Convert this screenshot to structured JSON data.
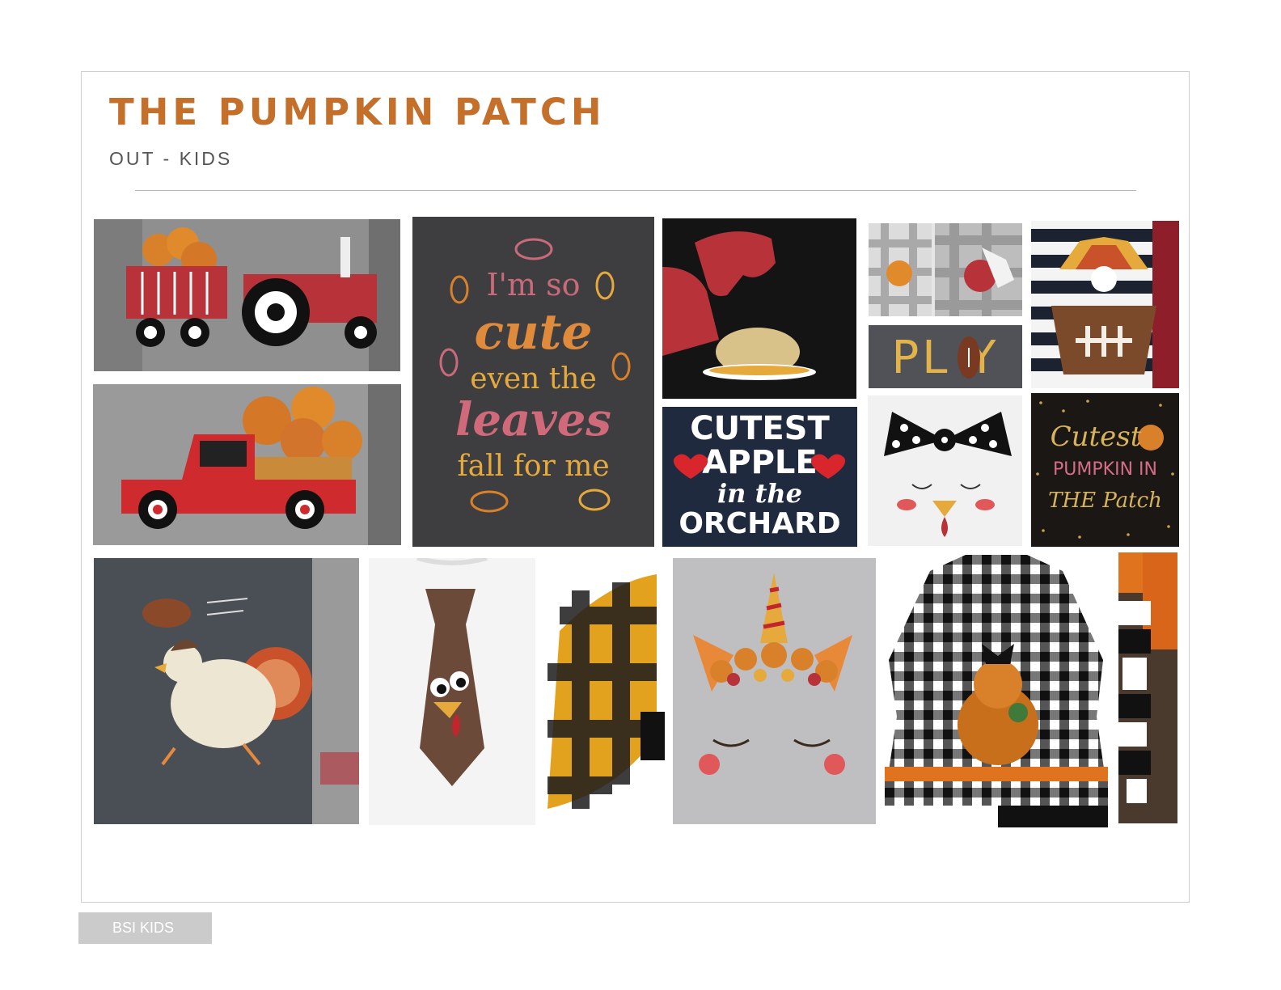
{
  "header": {
    "title": "THE PUMPKIN PATCH",
    "subtitle": "OUT - KIDS"
  },
  "tiles": {
    "cute_leaves": [
      "I'm so",
      "cute",
      "even the",
      "leaves",
      "fall for me"
    ],
    "cutest_apple": [
      "CUTEST",
      "APPLE",
      "in the",
      "ORCHARD"
    ],
    "play": "PL Y",
    "cutest_pumpkin": [
      "Cutest",
      "PUMPKIN IN",
      "THE Patch"
    ]
  },
  "images": {
    "tractor": "gray raglan tee with red tractor pulling pumpkin wagon",
    "truck": "gray tee with red truck carrying pumpkins",
    "trex": "black tee with t-rex eating turkey",
    "turkey_gingham": "gingham turkey applique outfits",
    "turkey_football": "striped tee with turkey holding football",
    "bow_turkey": "white tee with polka dot bow turkey face",
    "football_turkey": "charcoal raglan tee with turkey chasing football",
    "tie": "white tee with turkey necktie",
    "plaid": "orange buffalo plaid sleeve",
    "unicorn": "gray tee with autumn unicorn face",
    "gingham_dress": "black gingham dress with pumpkin applique",
    "plaid_edge": "black and white plaid set"
  },
  "footer": {
    "label": "BSI KIDS"
  },
  "colors": {
    "title": "#c46f2a",
    "frame": "#cfcfcf",
    "footer_bg": "#cbcbcb"
  }
}
